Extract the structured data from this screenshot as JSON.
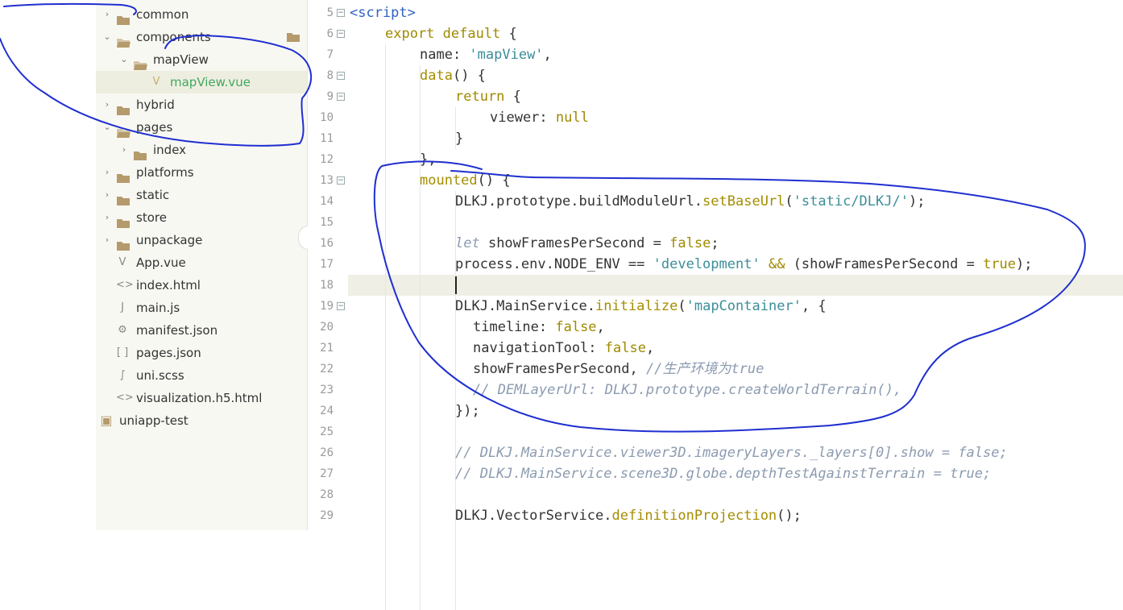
{
  "file_tree": {
    "items": [
      {
        "label": "common",
        "kind": "folder",
        "depth": 0,
        "expanded": false
      },
      {
        "label": "components",
        "kind": "folder",
        "depth": 0,
        "expanded": true
      },
      {
        "label": "mapView",
        "kind": "folder",
        "depth": 1,
        "expanded": true
      },
      {
        "label": "mapView.vue",
        "kind": "vue",
        "depth": 2,
        "selected": true
      },
      {
        "label": "hybrid",
        "kind": "folder",
        "depth": 0,
        "expanded": false
      },
      {
        "label": "pages",
        "kind": "folder",
        "depth": 0,
        "expanded": true
      },
      {
        "label": "index",
        "kind": "folder",
        "depth": 1,
        "expanded": false
      },
      {
        "label": "platforms",
        "kind": "folder",
        "depth": 0,
        "expanded": false
      },
      {
        "label": "static",
        "kind": "folder",
        "depth": 0,
        "expanded": false
      },
      {
        "label": "store",
        "kind": "folder",
        "depth": 0,
        "expanded": false
      },
      {
        "label": "unpackage",
        "kind": "folder",
        "depth": 0,
        "expanded": false
      },
      {
        "label": "App.vue",
        "kind": "vue",
        "depth": 0
      },
      {
        "label": "index.html",
        "kind": "html",
        "depth": 0
      },
      {
        "label": "main.js",
        "kind": "js",
        "depth": 0
      },
      {
        "label": "manifest.json",
        "kind": "manifest",
        "depth": 0
      },
      {
        "label": "pages.json",
        "kind": "json",
        "depth": 0
      },
      {
        "label": "uni.scss",
        "kind": "scss",
        "depth": 0
      },
      {
        "label": "visualization.h5.html",
        "kind": "html",
        "depth": 0
      },
      {
        "label": "uniapp-test",
        "kind": "project",
        "depth": -1
      }
    ]
  },
  "editor": {
    "current_line": "18",
    "lines": [
      {
        "n": "5",
        "fold": true,
        "indent": 0,
        "tokens": [
          [
            "tag",
            "<script>"
          ]
        ]
      },
      {
        "n": "6",
        "fold": true,
        "indent": 1,
        "tokens": [
          [
            "kw",
            "export default"
          ],
          [
            "p",
            " {"
          ]
        ]
      },
      {
        "n": "7",
        "fold": false,
        "indent": 2,
        "tokens": [
          [
            "p",
            "name: "
          ],
          [
            "str",
            "'mapView'"
          ],
          [
            "p",
            ","
          ]
        ]
      },
      {
        "n": "8",
        "fold": true,
        "indent": 2,
        "tokens": [
          [
            "fn",
            "data"
          ],
          [
            "p",
            "() {"
          ]
        ]
      },
      {
        "n": "9",
        "fold": true,
        "indent": 3,
        "tokens": [
          [
            "kw",
            "return"
          ],
          [
            "p",
            " {"
          ]
        ]
      },
      {
        "n": "10",
        "fold": false,
        "indent": 4,
        "tokens": [
          [
            "p",
            "viewer: "
          ],
          [
            "kw",
            "null"
          ]
        ]
      },
      {
        "n": "11",
        "fold": false,
        "indent": 3,
        "tokens": [
          [
            "p",
            "}"
          ]
        ]
      },
      {
        "n": "12",
        "fold": false,
        "indent": 2,
        "tokens": [
          [
            "p",
            "},"
          ]
        ]
      },
      {
        "n": "13",
        "fold": true,
        "indent": 2,
        "tokens": [
          [
            "fn",
            "mounted"
          ],
          [
            "p",
            "() {"
          ]
        ]
      },
      {
        "n": "14",
        "fold": false,
        "indent": 3,
        "tokens": [
          [
            "p",
            "DLKJ.prototype.buildModuleUrl."
          ],
          [
            "fn",
            "setBaseUrl"
          ],
          [
            "p",
            "("
          ],
          [
            "str",
            "'static/DLKJ/'"
          ],
          [
            "p",
            ");"
          ]
        ]
      },
      {
        "n": "15",
        "fold": false,
        "indent": 0,
        "tokens": []
      },
      {
        "n": "16",
        "fold": false,
        "indent": 3,
        "tokens": [
          [
            "cm",
            "let"
          ],
          [
            "p",
            " showFramesPerSecond = "
          ],
          [
            "kw",
            "false"
          ],
          [
            "p",
            ";"
          ]
        ]
      },
      {
        "n": "17",
        "fold": false,
        "indent": 3,
        "tokens": [
          [
            "p",
            "process.env.NODE_ENV == "
          ],
          [
            "str",
            "'development'"
          ],
          [
            "p",
            " "
          ],
          [
            "kw",
            "&&"
          ],
          [
            "p",
            " (showFramesPerSecond = "
          ],
          [
            "kw",
            "true"
          ],
          [
            "p",
            ");"
          ]
        ]
      },
      {
        "n": "18",
        "fold": false,
        "indent": 0,
        "tokens": []
      },
      {
        "n": "19",
        "fold": true,
        "indent": 3,
        "tokens": [
          [
            "p",
            "DLKJ.MainService."
          ],
          [
            "fn",
            "initialize"
          ],
          [
            "p",
            "("
          ],
          [
            "str",
            "'mapContainer'"
          ],
          [
            "p",
            ", {"
          ]
        ]
      },
      {
        "n": "20",
        "fold": false,
        "indent": 3.5,
        "tokens": [
          [
            "p",
            "timeline: "
          ],
          [
            "kw",
            "false"
          ],
          [
            "p",
            ","
          ]
        ]
      },
      {
        "n": "21",
        "fold": false,
        "indent": 3.5,
        "tokens": [
          [
            "p",
            "navigationTool: "
          ],
          [
            "kw",
            "false"
          ],
          [
            "p",
            ","
          ]
        ]
      },
      {
        "n": "22",
        "fold": false,
        "indent": 3.5,
        "tokens": [
          [
            "p",
            "showFramesPerSecond, "
          ],
          [
            "cm",
            "//生产环境为true"
          ]
        ]
      },
      {
        "n": "23",
        "fold": false,
        "indent": 3.5,
        "tokens": [
          [
            "cm",
            "// DEMLayerUrl: DLKJ.prototype.createWorldTerrain(),"
          ]
        ]
      },
      {
        "n": "24",
        "fold": false,
        "indent": 3,
        "tokens": [
          [
            "p",
            "});"
          ]
        ]
      },
      {
        "n": "25",
        "fold": false,
        "indent": 0,
        "tokens": []
      },
      {
        "n": "26",
        "fold": false,
        "indent": 3,
        "tokens": [
          [
            "cm",
            "// DLKJ.MainService.viewer3D.imageryLayers._layers[0].show = false;"
          ]
        ]
      },
      {
        "n": "27",
        "fold": false,
        "indent": 3,
        "tokens": [
          [
            "cm",
            "// DLKJ.MainService.scene3D.globe.depthTestAgainstTerrain = true;"
          ]
        ]
      },
      {
        "n": "28",
        "fold": false,
        "indent": 0,
        "tokens": []
      },
      {
        "n": "29",
        "fold": false,
        "indent": 3,
        "tokens": [
          [
            "p",
            "DLKJ.VectorService."
          ],
          [
            "fn",
            "definitionProjection"
          ],
          [
            "p",
            "();"
          ]
        ]
      }
    ]
  },
  "colors": {
    "folder": "#b59a6b",
    "selected_text": "#41a85f",
    "annotation_ink": "#1f2fd0"
  }
}
